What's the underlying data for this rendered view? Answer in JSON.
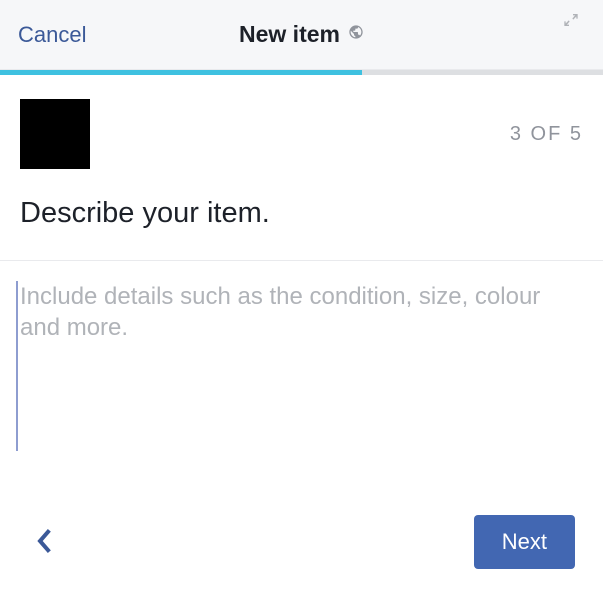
{
  "header": {
    "cancel_label": "Cancel",
    "title": "New item"
  },
  "progress": {
    "percent": 60,
    "step_current": 3,
    "step_total": 5,
    "step_label": "3 OF 5"
  },
  "main": {
    "heading": "Describe your item.",
    "description_value": "",
    "description_placeholder": "Include details such as the condition, size, colour and more."
  },
  "footer": {
    "next_label": "Next"
  },
  "colors": {
    "accent": "#4267b2",
    "progress": "#3ec1e0"
  }
}
